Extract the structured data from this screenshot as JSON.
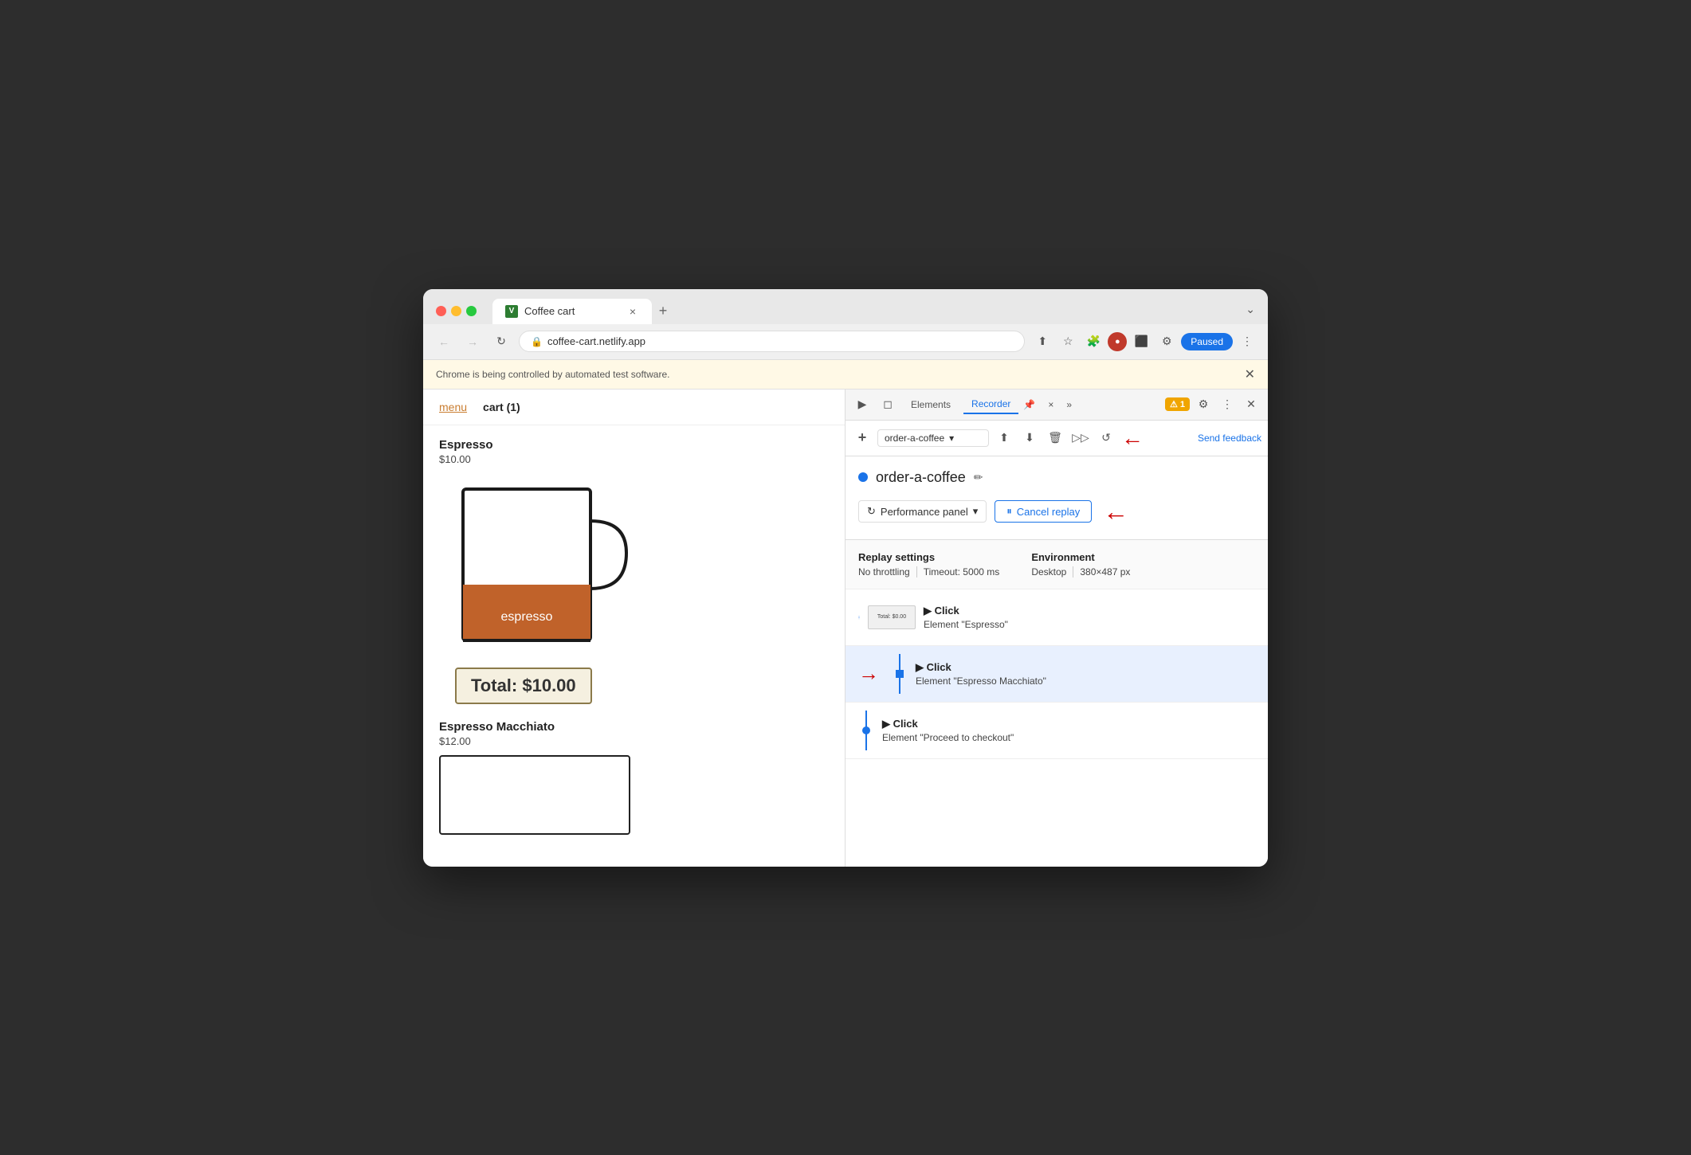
{
  "browser": {
    "tab_title": "Coffee cart",
    "tab_favicon": "V",
    "url": "coffee-cart.netlify.app",
    "paused_label": "Paused",
    "automation_notice": "Chrome is being controlled by automated test software.",
    "new_tab_symbol": "+",
    "chevron_symbol": "⌄"
  },
  "site": {
    "nav_menu": "menu",
    "nav_cart": "cart (1)",
    "product1_name": "Espresso",
    "product1_price": "$10.00",
    "product1_label": "espresso",
    "product2_name": "Espresso Macchiato",
    "product2_price": "$12.00",
    "total_label": "Total: $10.00"
  },
  "devtools": {
    "tab_elements": "Elements",
    "tab_recorder": "Recorder",
    "tab_pin": "📌",
    "tab_close": "×",
    "tab_more": "»",
    "badge_count": "1",
    "send_feedback": "Send feedback",
    "recording_name": "order-a-coffee",
    "recording_dropdown_arrow": "▾",
    "replay_settings_title": "Replay settings",
    "environment_title": "Environment",
    "no_throttling": "No throttling",
    "timeout": "Timeout: 5000 ms",
    "desktop": "Desktop",
    "viewport": "380×487 px",
    "perf_panel_label": "Performance panel",
    "cancel_replay_label": "Cancel replay",
    "steps": [
      {
        "action": "Click",
        "element": "Element \"Espresso\"",
        "highlighted": false,
        "thumbnail": "Total: $0.00",
        "dot_type": "circle"
      },
      {
        "action": "Click",
        "element": "Element \"Espresso Macchiato\"",
        "highlighted": true,
        "thumbnail": null,
        "dot_type": "square"
      },
      {
        "action": "Click",
        "element": "Element \"Proceed to checkout\"",
        "highlighted": false,
        "thumbnail": null,
        "dot_type": "circle"
      }
    ]
  }
}
